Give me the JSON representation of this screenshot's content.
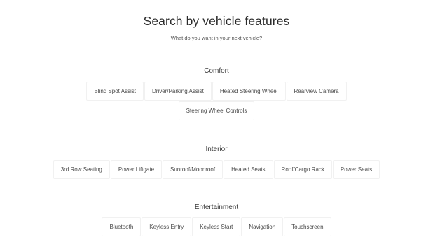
{
  "header": {
    "title": "Search by vehicle features",
    "subtitle": "What do you want in your next vehicle?"
  },
  "sections": [
    {
      "title": "Comfort",
      "rows": [
        [
          "Blind Spot Assist",
          "Driver/Parking Assist",
          "Heated Steering Wheel",
          "Rearview Camera"
        ],
        [
          "Steering Wheel Controls"
        ]
      ]
    },
    {
      "title": "Interior",
      "rows": [
        [
          "3rd Row Seating",
          "Power Liftgate",
          "Sunroof/Moonroof",
          "Heated Seats",
          "Roof/Cargo Rack",
          "Power Seats"
        ]
      ]
    },
    {
      "title": "Entertainment",
      "rows": [
        [
          "Bluetooth",
          "Keyless Entry",
          "Keyless Start",
          "Navigation",
          "Touchscreen"
        ]
      ]
    }
  ]
}
